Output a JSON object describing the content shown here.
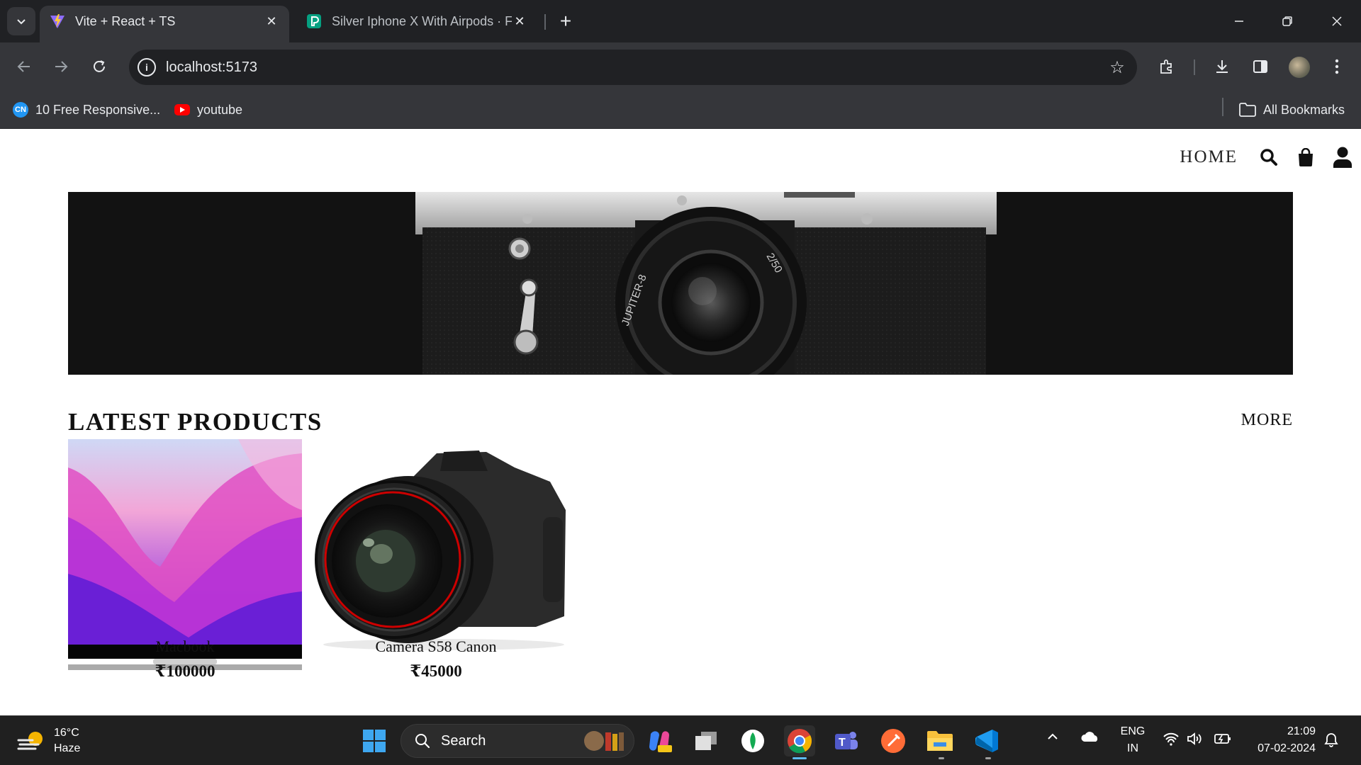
{
  "browser": {
    "tabs": [
      {
        "title": "Vite + React + TS",
        "active": true,
        "favicon": "vite-icon"
      },
      {
        "title": "Silver Iphone X With Airpods · F",
        "active": false,
        "favicon": "pexels-icon"
      }
    ],
    "url": "localhost:5173",
    "bookmarks": [
      {
        "label": "10 Free Responsive...",
        "icon": "codingnepal-icon"
      },
      {
        "label": "youtube",
        "icon": "youtube-icon"
      }
    ],
    "all_bookmarks": "All Bookmarks"
  },
  "site": {
    "nav": {
      "home": "HOME",
      "icons": [
        "search-icon",
        "shopping-bag-icon",
        "user-icon"
      ]
    },
    "hero_image": "vintage-camera-banner",
    "section_title": "LATEST PRODUCTS",
    "more_label": "MORE",
    "products": [
      {
        "name": "Macbook",
        "price": "₹100000",
        "image": "macbook-image"
      },
      {
        "name": "Camera S58 Canon",
        "price": "₹45000",
        "image": "canon-camera-image"
      }
    ]
  },
  "taskbar": {
    "weather": {
      "temp": "16°C",
      "condition": "Haze"
    },
    "search_placeholder": "Search",
    "language": {
      "line1": "ENG",
      "line2": "IN"
    },
    "time": "21:09",
    "date": "07-02-2024"
  },
  "colors": {
    "chrome_dark": "#202124",
    "chrome_toolbar": "#35363a",
    "page_bg": "#ffffff",
    "taskbar": "#202020"
  }
}
